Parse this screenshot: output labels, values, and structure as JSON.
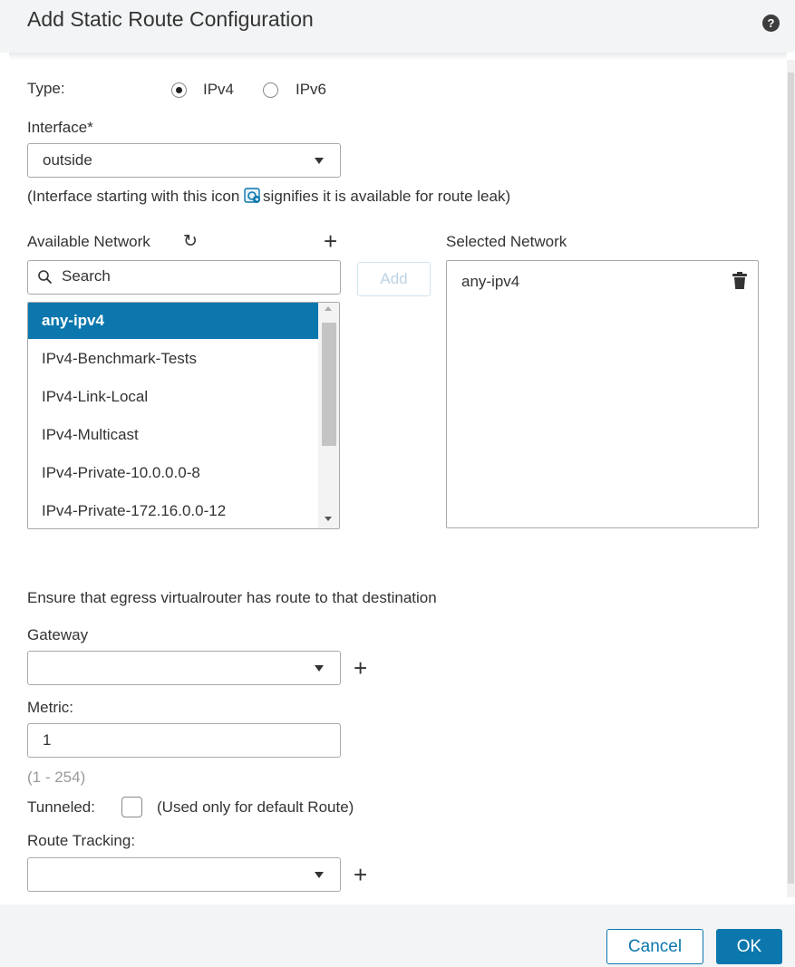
{
  "dialog": {
    "title": "Add Static Route Configuration",
    "help_icon": "?"
  },
  "type": {
    "label": "Type:",
    "options": [
      {
        "label": "IPv4",
        "checked": true
      },
      {
        "label": "IPv6",
        "checked": false
      }
    ]
  },
  "interface": {
    "label": "Interface*",
    "value": "outside",
    "hint_prefix": "(Interface starting with this icon ",
    "hint_suffix": "signifies it is available for route leak)"
  },
  "available_network": {
    "label": "Available Network",
    "refresh_icon": "↻",
    "add_icon": "+",
    "search_placeholder": "Search",
    "items": [
      "any-ipv4",
      "IPv4-Benchmark-Tests",
      "IPv4-Link-Local",
      "IPv4-Multicast",
      "IPv4-Private-10.0.0.0-8",
      "IPv4-Private-172.16.0.0-12"
    ],
    "selected_index": 0
  },
  "add_button": "Add",
  "selected_network": {
    "label": "Selected Network",
    "items": [
      "any-ipv4"
    ]
  },
  "egress_note": "Ensure that egress virtualrouter has route to that destination",
  "gateway": {
    "label": "Gateway",
    "value": "",
    "add_icon": "+"
  },
  "metric": {
    "label": "Metric:",
    "value": "1",
    "range": "(1 - 254)"
  },
  "tunneled": {
    "label": "Tunneled:",
    "checked": false,
    "note": "(Used only for default Route)"
  },
  "route_tracking": {
    "label": "Route Tracking:",
    "value": "",
    "add_icon": "+"
  },
  "footer": {
    "cancel": "Cancel",
    "ok": "OK"
  },
  "colors": {
    "accent": "#0b77ad",
    "header_bg": "#f3f4f5",
    "text": "#333333"
  }
}
